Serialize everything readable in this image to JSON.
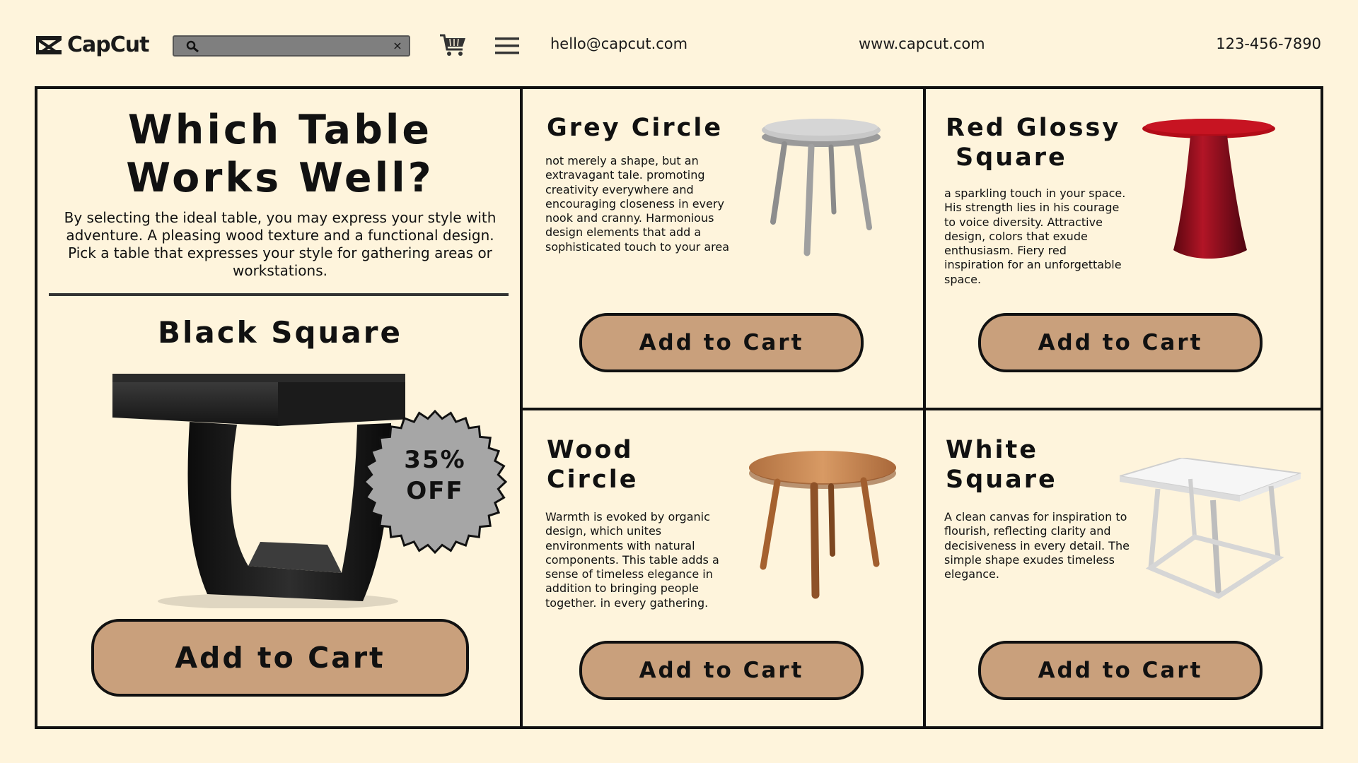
{
  "header": {
    "logo_text": "CapCut",
    "search": {
      "value": "",
      "placeholder": "",
      "clear_label": "×"
    },
    "email": "hello@capcut.com",
    "website": "www.capcut.com",
    "phone": "123-456-7890"
  },
  "intro": {
    "title_line1": "Which Table",
    "title_line2": "Works Well?",
    "description": "By selecting the ideal table, you may express your style with adventure. A pleasing wood texture and a functional design. Pick a table that expresses your style for gathering areas or workstations."
  },
  "featured": {
    "name": "Black Square",
    "badge_line1": "35%",
    "badge_line2": "OFF",
    "button_label": "Add to Cart"
  },
  "products": [
    {
      "name_line1": "Grey Circle",
      "name_line2": "",
      "description": "not merely a shape, but an extravagant tale. promoting creativity everywhere and encouraging closeness in every nook and cranny. Harmonious design elements that add a sophisticated touch to your area",
      "button_label": "Add to Cart"
    },
    {
      "name_line1": "Red Glossy",
      "name_line2": "Square",
      "description": "a sparkling touch in your space. His strength lies in his courage to voice diversity. Attractive design, colors that exude enthusiasm. Fiery red inspiration for an unforgettable space.",
      "button_label": "Add to Cart"
    },
    {
      "name_line1": "Wood",
      "name_line2": "Circle",
      "description": "Warmth is evoked by organic design, which unites environments with natural components. This table adds a sense of timeless elegance in addition to bringing people together.  in every gathering.",
      "button_label": "Add to Cart"
    },
    {
      "name_line1": "White",
      "name_line2": "Square",
      "description": "A clean canvas for inspiration to flourish, reflecting clarity and decisiveness in every detail. The simple shape exudes timeless elegance.",
      "button_label": "Add to Cart"
    }
  ],
  "icons": [
    "capcut-logo-icon",
    "search-icon",
    "close-icon",
    "cart-icon",
    "menu-icon"
  ],
  "colors": {
    "background": "#fef4dc",
    "button": "#c9a07c",
    "border": "#111111",
    "badge": "#a6a6a6",
    "search_bar": "#7f7f7f"
  }
}
